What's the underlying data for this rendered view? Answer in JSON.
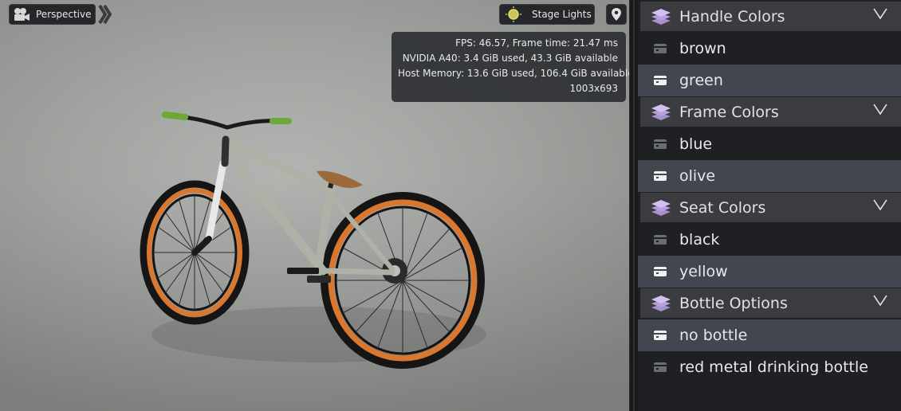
{
  "viewport": {
    "camera_label": "Perspective",
    "lights_label": "Stage Lights",
    "stats": {
      "fps_line": "FPS: 46.57, Frame time: 21.47 ms",
      "gpu_line": "NVIDIA A40: 3.4 GiB used, 43.3 GiB available",
      "host_line": "Host Memory: 13.6 GiB used, 106.4 GiB available",
      "resolution_line": "1003x693"
    }
  },
  "panel": {
    "groups": [
      {
        "title": "Handle Colors",
        "options": [
          {
            "label": "brown",
            "selected": false
          },
          {
            "label": "green",
            "selected": true
          }
        ]
      },
      {
        "title": "Frame Colors",
        "options": [
          {
            "label": "blue",
            "selected": false
          },
          {
            "label": "olive",
            "selected": true
          }
        ]
      },
      {
        "title": "Seat Colors",
        "options": [
          {
            "label": "black",
            "selected": false
          },
          {
            "label": "yellow",
            "selected": true
          }
        ]
      },
      {
        "title": "Bottle Options",
        "options": [
          {
            "label": "no bottle",
            "selected": true
          },
          {
            "label": "red metal drinking bottle",
            "selected": false
          }
        ]
      }
    ]
  },
  "colors": {
    "header_bg": "#3b3c3f",
    "row_selected_bg": "#42464f",
    "row_bg": "#1f2023",
    "tire_orange": "#d9772f"
  }
}
